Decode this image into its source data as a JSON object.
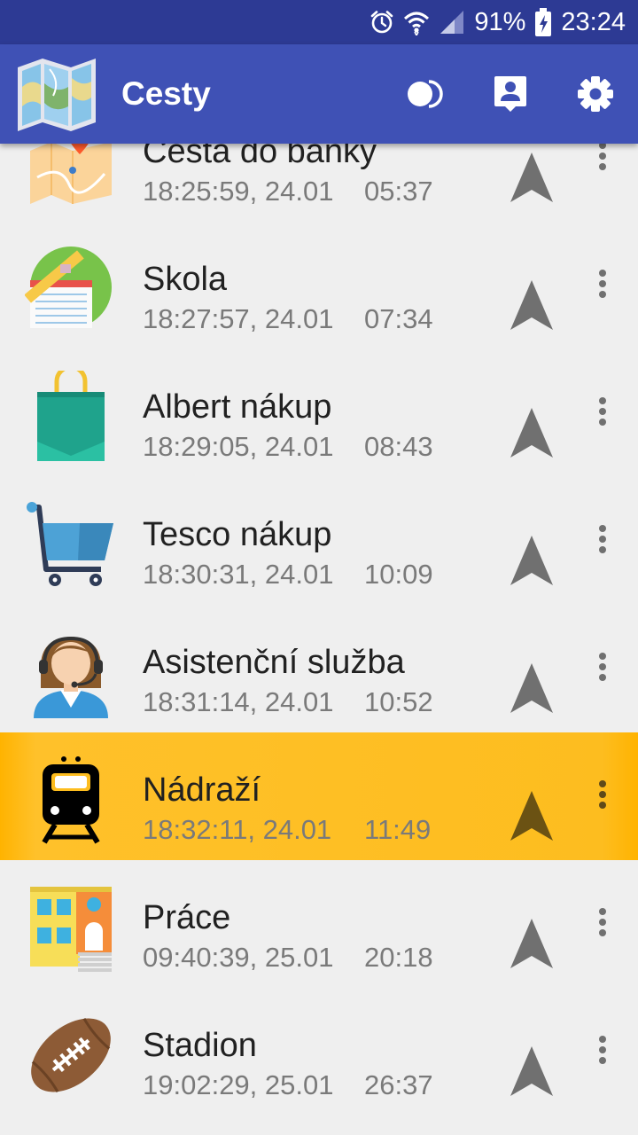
{
  "status_bar": {
    "battery": "91%",
    "time": "23:24",
    "icons": [
      "alarm-icon",
      "wifi-icon",
      "signal-icon",
      "battery-charging-icon"
    ]
  },
  "app_bar": {
    "title": "Cesty",
    "logo_icon": "map-icon",
    "actions": [
      "toggle-icon",
      "contact-pin-icon",
      "gear-icon"
    ]
  },
  "colors": {
    "status_bar": "#2d3a94",
    "app_bar": "#3f51b5",
    "background": "#efefef",
    "highlight": "#ffc12a",
    "nav_arrow": "#707070",
    "nav_arrow_active": "#6b5213"
  },
  "routes": [
    {
      "title": "Cesta do banky",
      "time": "18:25:59, 24.01",
      "duration": "05:37",
      "icon": "map-pin-icon",
      "active": false
    },
    {
      "title": "Skola",
      "time": "18:27:57, 24.01",
      "duration": "07:34",
      "icon": "school-notebook-icon",
      "active": false
    },
    {
      "title": "Albert nákup",
      "time": "18:29:05, 24.01",
      "duration": "08:43",
      "icon": "shopping-bag-icon",
      "active": false
    },
    {
      "title": "Tesco nákup",
      "time": "18:30:31, 24.01",
      "duration": "10:09",
      "icon": "shopping-cart-icon",
      "active": false
    },
    {
      "title": "Asistenční služba",
      "time": "18:31:14, 24.01",
      "duration": "10:52",
      "icon": "support-agent-icon",
      "active": false
    },
    {
      "title": "Nádraží",
      "time": "18:32:11, 24.01",
      "duration": "11:49",
      "icon": "train-icon",
      "active": true
    },
    {
      "title": "Práce",
      "time": "09:40:39, 25.01",
      "duration": "20:18",
      "icon": "building-icon",
      "active": false
    },
    {
      "title": "Stadion",
      "time": "19:02:29, 25.01",
      "duration": "26:37",
      "icon": "football-icon",
      "active": false
    }
  ]
}
